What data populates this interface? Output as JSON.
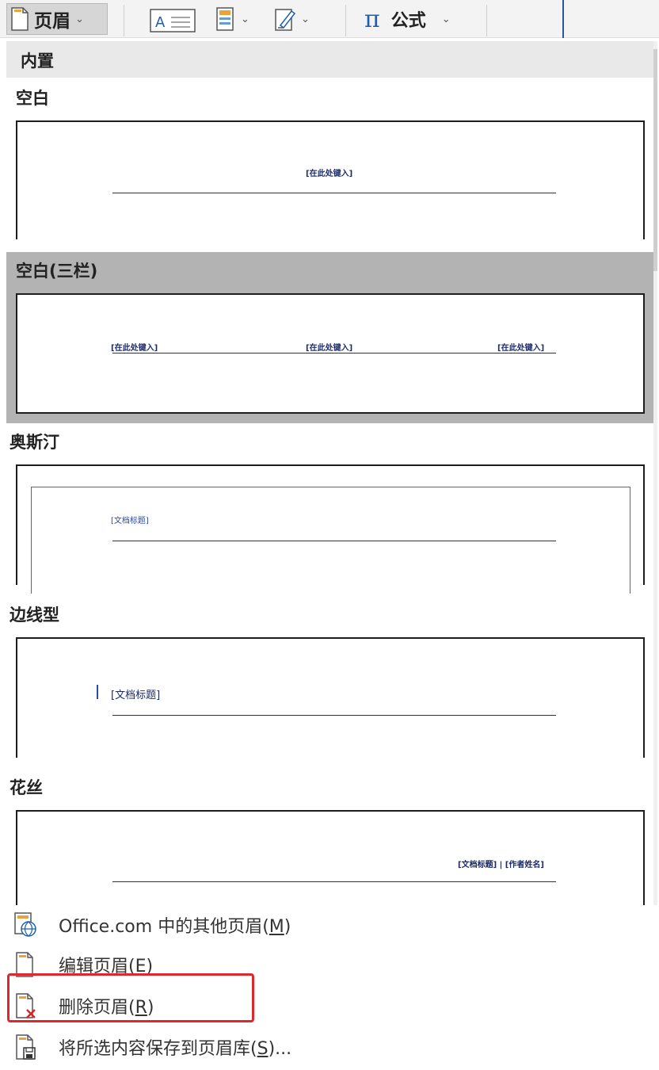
{
  "ribbon": {
    "header_button": {
      "label": "页眉",
      "icon": "page-header-icon"
    },
    "textbox_button": {
      "glyph": "A",
      "icon": "text-box-icon"
    },
    "quick_parts_button": {
      "icon": "quick-parts-icon"
    },
    "wordart_button": {
      "icon": "signature-line-icon"
    },
    "equation_button": {
      "glyph": "π",
      "label": "公式",
      "icon": "equation-icon"
    },
    "chevron": "⌄"
  },
  "gallery": {
    "section_header": "内置",
    "items": [
      {
        "title": "空白",
        "placeholders": [
          "[在此处键入]"
        ]
      },
      {
        "title": "空白(三栏)",
        "placeholders": [
          "[在此处键入]",
          "[在此处键入]",
          "[在此处键入]"
        ],
        "selected": true
      },
      {
        "title": "奥斯汀",
        "placeholders": [
          "[文档标题]"
        ]
      },
      {
        "title": "边线型",
        "placeholders": [
          "[文档标题]"
        ]
      },
      {
        "title": "花丝",
        "placeholders": [
          "[文档标题] | [作者姓名]"
        ]
      }
    ]
  },
  "menu": {
    "more_headers": {
      "text": "Office.com 中的其他页眉(",
      "key": "M",
      "suffix": ")",
      "icon": "office-web-icon"
    },
    "edit_header": {
      "text": "编辑页眉(",
      "key": "E",
      "suffix": ")",
      "icon": "edit-header-icon"
    },
    "remove_header": {
      "text": "删除页眉(",
      "key": "R",
      "suffix": ")",
      "icon": "remove-header-icon",
      "highlighted": true
    },
    "save_selection": {
      "text": "将所选内容保存到页眉库(",
      "key": "S",
      "suffix": ")...",
      "icon": "save-to-gallery-icon"
    }
  },
  "colors": {
    "highlight_box": "#e0282c",
    "selected_item": "#b3b3b3",
    "accent_blue": "#1f5fb0"
  }
}
